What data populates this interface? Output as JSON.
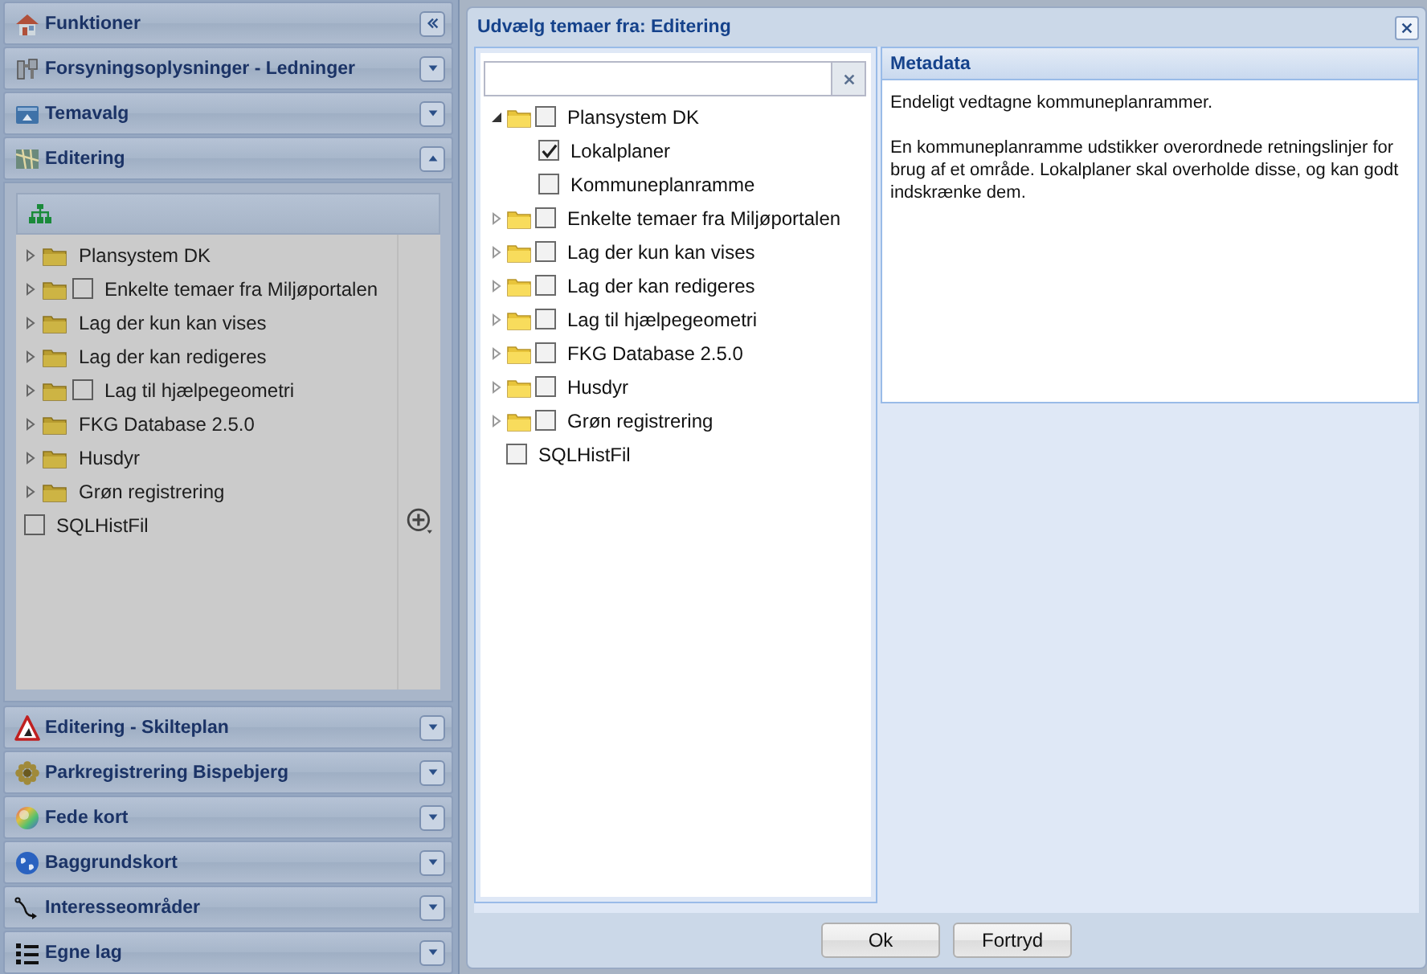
{
  "sidebar": {
    "sections": [
      {
        "title": "Funktioner",
        "kind": "main",
        "expanded": true
      },
      {
        "title": "Forsyningsoplysninger - Ledninger",
        "kind": "panel",
        "expanded": false
      },
      {
        "title": "Temavalg",
        "kind": "panel",
        "expanded": false
      },
      {
        "title": "Editering",
        "kind": "panel",
        "expanded": true,
        "tree": [
          {
            "label": "Plansystem DK",
            "kind": "folder",
            "expanded": false
          },
          {
            "label": "Enkelte temaer fra Miljøportalen",
            "kind": "folder-checkbox",
            "expanded": false,
            "checked": false
          },
          {
            "label": "Lag der kun kan vises",
            "kind": "folder",
            "expanded": false
          },
          {
            "label": "Lag der kan redigeres",
            "kind": "folder",
            "expanded": false
          },
          {
            "label": "Lag til hjælpegeometri",
            "kind": "folder-checkbox",
            "expanded": false,
            "checked": false
          },
          {
            "label": "FKG Database 2.5.0",
            "kind": "folder",
            "expanded": false
          },
          {
            "label": "Husdyr",
            "kind": "folder",
            "expanded": false
          },
          {
            "label": "Grøn registrering",
            "kind": "folder",
            "expanded": false
          },
          {
            "label": "SQLHistFil",
            "kind": "layer",
            "checked": false
          }
        ]
      },
      {
        "title": "Editering - Skilteplan",
        "kind": "panel",
        "expanded": false
      },
      {
        "title": "Parkregistrering Bispebjerg",
        "kind": "panel",
        "expanded": false
      },
      {
        "title": "Fede kort",
        "kind": "panel",
        "expanded": false
      },
      {
        "title": "Baggrundskort",
        "kind": "panel",
        "expanded": false
      },
      {
        "title": "Interesseområder",
        "kind": "panel",
        "expanded": false
      },
      {
        "title": "Egne lag",
        "kind": "panel",
        "expanded": false
      }
    ]
  },
  "dialog": {
    "title": "Udvælg temaer fra: Editering",
    "tree": [
      {
        "label": "Plansystem DK",
        "kind": "folder-checkbox",
        "expanded": true,
        "checked": false,
        "children": [
          {
            "label": "Lokalplaner",
            "kind": "layer",
            "checked": true
          },
          {
            "label": "Kommuneplanramme",
            "kind": "layer",
            "checked": false
          }
        ]
      },
      {
        "label": "Enkelte temaer fra Miljøportalen",
        "kind": "folder-checkbox",
        "expanded": false,
        "checked": false
      },
      {
        "label": "Lag der kun kan vises",
        "kind": "folder-checkbox",
        "expanded": false,
        "checked": false
      },
      {
        "label": "Lag der kan redigeres",
        "kind": "folder-checkbox",
        "expanded": false,
        "checked": false
      },
      {
        "label": "Lag til hjælpegeometri",
        "kind": "folder-checkbox",
        "expanded": false,
        "checked": false
      },
      {
        "label": "FKG Database 2.5.0",
        "kind": "folder-checkbox",
        "expanded": false,
        "checked": false
      },
      {
        "label": "Husdyr",
        "kind": "folder-checkbox",
        "expanded": false,
        "checked": false
      },
      {
        "label": "Grøn registrering",
        "kind": "folder-checkbox",
        "expanded": false,
        "checked": false
      },
      {
        "label": "SQLHistFil",
        "kind": "layer",
        "checked": false
      }
    ],
    "metadata": {
      "title": "Metadata",
      "paragraphs": [
        "Endeligt vedtagne kommuneplanrammer.",
        "En kommuneplanramme udstikker overordnede retningslinjer for brug af et område. Lokalplaner skal overholde disse, og kan godt indskrænke dem."
      ]
    },
    "buttons": [
      "Ok",
      "Fortryd"
    ]
  }
}
